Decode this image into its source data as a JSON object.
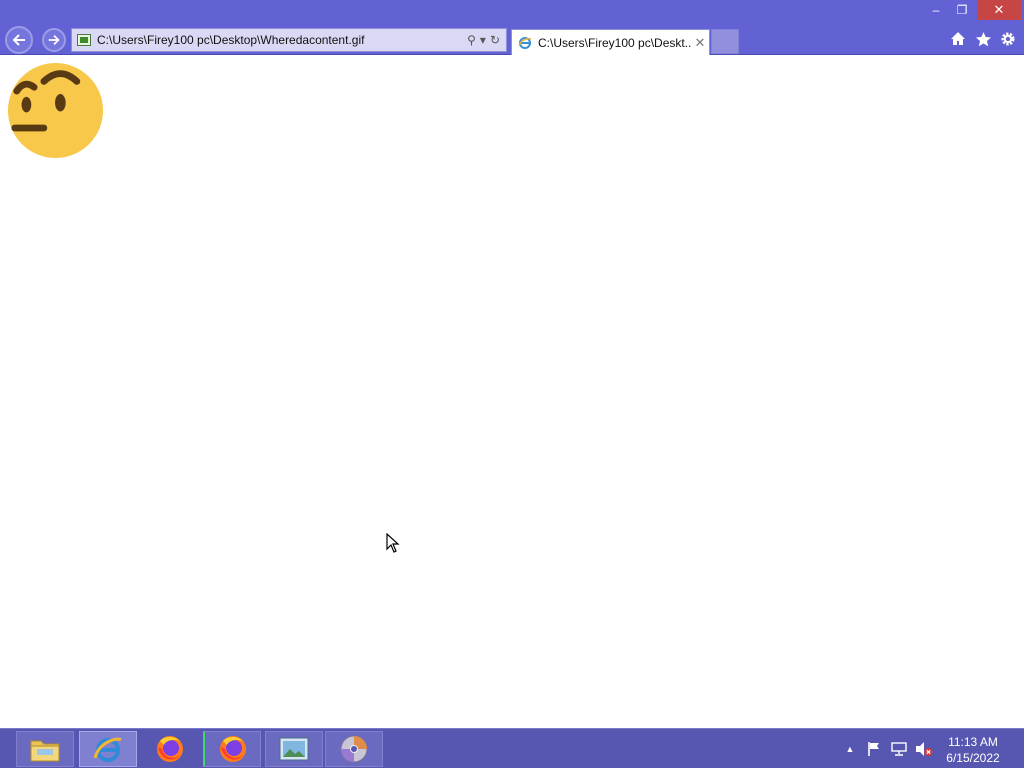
{
  "window": {
    "minimize_glyph": "–",
    "maximize_glyph": "❐",
    "close_glyph": "✕"
  },
  "browser": {
    "address_bar": {
      "url": "C:\\Users\\Firey100 pc\\Desktop\\Wheredacontent.gif",
      "search_glyph": "⚲",
      "dropdown_glyph": "▾",
      "refresh_glyph": "↻"
    },
    "tabs": [
      {
        "title": "C:\\Users\\Firey100 pc\\Deskt...",
        "close_glyph": "✕",
        "active": true
      }
    ],
    "toolbar_icons": [
      "home-icon",
      "favorites-star-icon",
      "settings-gear-icon"
    ]
  },
  "content": {
    "image": "raised-eyebrow-emoji"
  },
  "taskbar": {
    "apps": [
      {
        "name": "file-explorer",
        "icon": "folder-icon"
      },
      {
        "name": "internet-explorer",
        "icon": "ie-icon",
        "state": "active"
      },
      {
        "name": "firefox",
        "icon": "firefox-icon"
      },
      {
        "name": "firefox-2",
        "icon": "firefox-icon",
        "state": "open"
      },
      {
        "name": "photo-viewer",
        "icon": "picture-icon",
        "state": "open"
      },
      {
        "name": "dvd-maker",
        "icon": "disc-icon",
        "state": "open"
      }
    ],
    "tray": {
      "show_hidden_glyph": "▲",
      "icons": [
        "action-center-flag-icon",
        "network-icon",
        "volume-muted-icon"
      ]
    },
    "clock": {
      "time": "11:13 AM",
      "date": "6/15/2022"
    }
  },
  "colors": {
    "chrome": "#6262d4",
    "taskbar": "#5757b2",
    "close_button": "#c64545",
    "emoji_face": "#f7c84a",
    "emoji_features": "#5a3a12"
  }
}
